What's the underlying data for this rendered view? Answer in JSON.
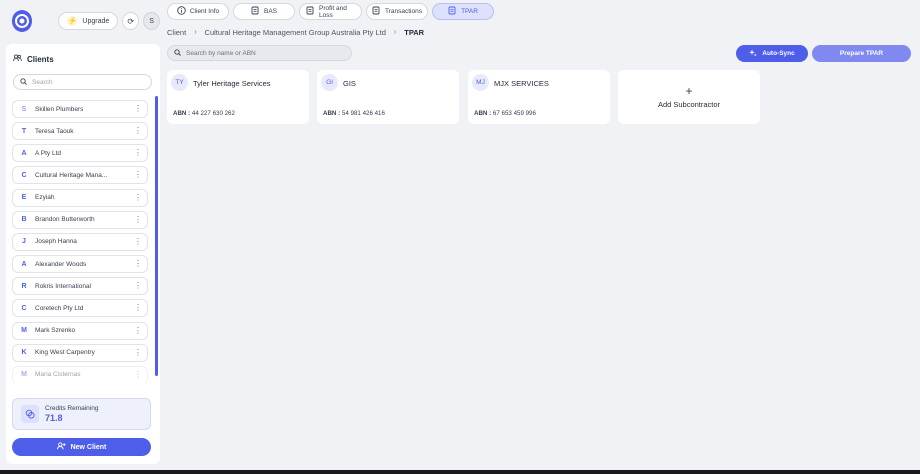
{
  "header": {
    "upgrade_label": "Upgrade",
    "avatar_initial": "S"
  },
  "sidebar": {
    "title": "Clients",
    "search_placeholder": "Search",
    "clients": [
      {
        "initial": "S",
        "name": "Skillen Plumbers"
      },
      {
        "initial": "T",
        "name": "Teresa Taouk"
      },
      {
        "initial": "A",
        "name": "A Pty Ltd"
      },
      {
        "initial": "C",
        "name": "Cultural Heritage Mana..."
      },
      {
        "initial": "E",
        "name": "Ezyiah"
      },
      {
        "initial": "B",
        "name": "Brandon Butterworth"
      },
      {
        "initial": "J",
        "name": "Joseph Hanna"
      },
      {
        "initial": "A",
        "name": "Alexander Woods"
      },
      {
        "initial": "R",
        "name": "Rokris International"
      },
      {
        "initial": "C",
        "name": "Coretech Pty Ltd"
      },
      {
        "initial": "M",
        "name": "Mark Szrenko"
      },
      {
        "initial": "K",
        "name": "King West Carpentry"
      },
      {
        "initial": "M",
        "name": "Maria Cisternas"
      }
    ],
    "credits_label": "Credits Remaining",
    "credits_value": "71.8",
    "new_client_label": "New Client"
  },
  "tabs": [
    {
      "label": "Client Info",
      "icon": "info-icon",
      "active": false
    },
    {
      "label": "BAS",
      "icon": "document-icon",
      "active": false
    },
    {
      "label": "Profit and Loss",
      "icon": "document-icon",
      "active": false
    },
    {
      "label": "Transactions",
      "icon": "document-icon",
      "active": false
    },
    {
      "label": "TPAR",
      "icon": "document-icon",
      "active": true
    }
  ],
  "breadcrumb": {
    "root": "Client",
    "client": "Cultural Heritage Management Group Australia Pty Ltd",
    "current": "TPAR"
  },
  "main": {
    "search_placeholder": "Search by name or ABN",
    "auto_sync_label": "Auto-Sync",
    "prepare_label": "Prepare TPAR",
    "abn_label": "ABN :",
    "subcontractors": [
      {
        "initials": "TY",
        "name": "Tyler Heritage Services",
        "abn": "44 227 630 262"
      },
      {
        "initials": "GI",
        "name": "GIS",
        "abn": "54 981 426 416"
      },
      {
        "initials": "MJ",
        "name": "MJX SERVICES",
        "abn": "67 653 459 996"
      }
    ],
    "add_label": "Add Subcontractor"
  },
  "colors": {
    "accent": "#4f5ee8",
    "accent_light": "#7f89f0"
  }
}
